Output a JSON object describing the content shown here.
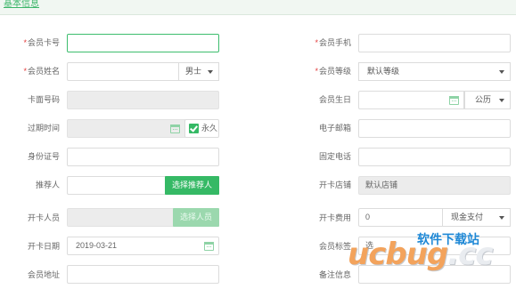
{
  "section": {
    "title": "基本信息"
  },
  "form": {
    "card_no": {
      "label": "会员卡号",
      "required": true,
      "value": ""
    },
    "mobile": {
      "label": "会员手机",
      "required": true,
      "value": ""
    },
    "name": {
      "label": "会员姓名",
      "required": true,
      "value": "",
      "gender": "男士"
    },
    "level": {
      "label": "会员等级",
      "required": true,
      "value": "默认等级"
    },
    "card_face_no": {
      "label": "卡面号码",
      "value": ""
    },
    "birthday": {
      "label": "会员生日",
      "value": "",
      "calendar_type": "公历"
    },
    "expiry": {
      "label": "过期时间",
      "value": "",
      "forever_label": "永久",
      "forever_checked": true
    },
    "email": {
      "label": "电子邮箱",
      "value": ""
    },
    "id_no": {
      "label": "身份证号",
      "value": ""
    },
    "phone": {
      "label": "固定电话",
      "value": ""
    },
    "referrer": {
      "label": "推荐人",
      "value": "",
      "button": "选择推荐人"
    },
    "open_store": {
      "label": "开卡店铺",
      "value": "默认店铺"
    },
    "open_staff": {
      "label": "开卡人员",
      "value": "",
      "button": "选择人员"
    },
    "open_fee": {
      "label": "开卡费用",
      "value": "0",
      "payment": "现金支付"
    },
    "open_date": {
      "label": "开卡日期",
      "value": "2019-03-21"
    },
    "tags": {
      "label": "会员标签",
      "value": "选"
    },
    "address": {
      "label": "会员地址",
      "value": ""
    },
    "remark": {
      "label": "备注信息",
      "value": ""
    }
  },
  "watermark": {
    "logo": "ucbug",
    "domain": ".cc",
    "text": "软件下载站"
  }
}
